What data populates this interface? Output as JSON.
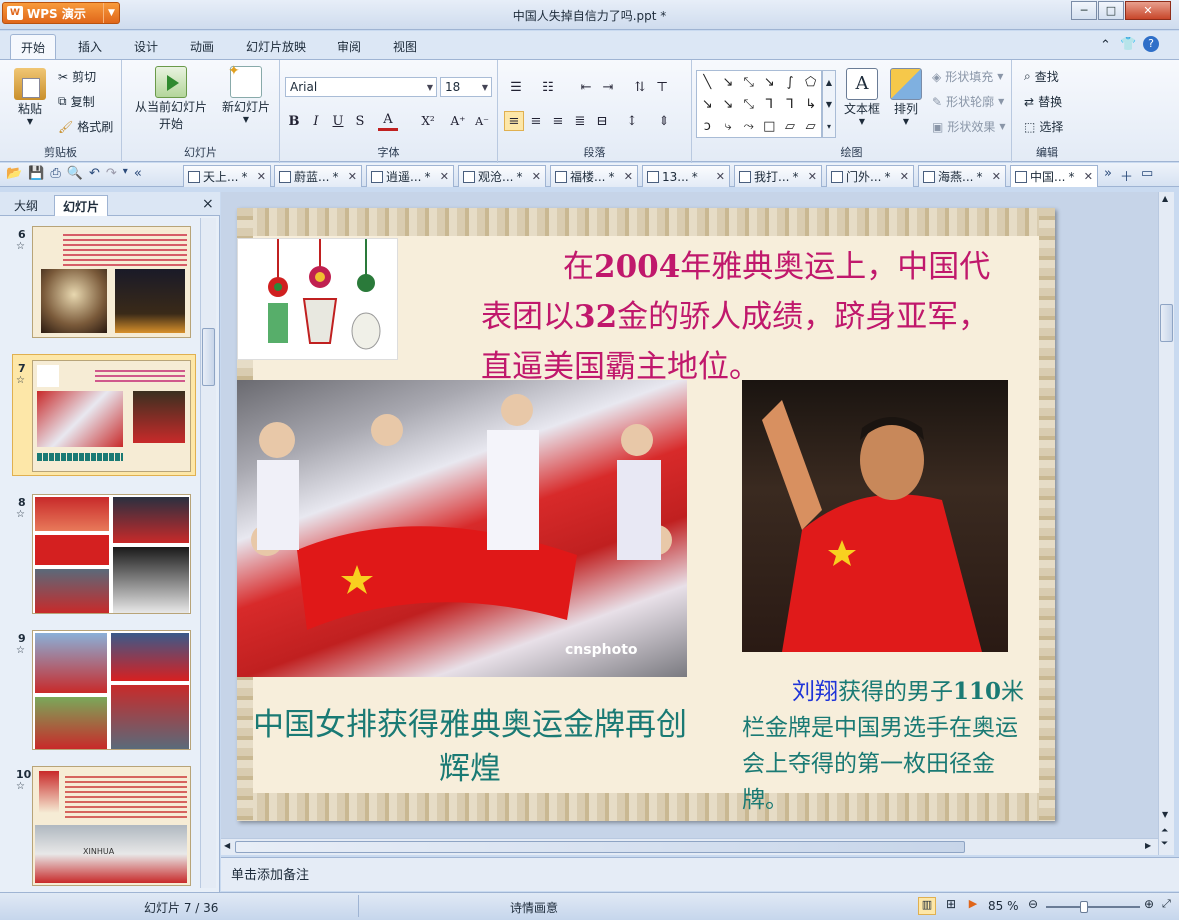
{
  "app": {
    "name": "WPS 演示",
    "doc_title": "中国人失掉自信力了吗.ppt *"
  },
  "window_controls": {
    "minimize": "─",
    "maximize": "□",
    "close": "✕"
  },
  "menu": {
    "tabs": [
      "开始",
      "插入",
      "设计",
      "动画",
      "幻灯片放映",
      "审阅",
      "视图"
    ],
    "right_icons": [
      "⌃",
      "👕",
      "?"
    ]
  },
  "ribbon": {
    "clipboard": {
      "paste": "粘贴",
      "cut": "剪切",
      "copy": "复制",
      "format_painter": "格式刷",
      "label": "剪贴板"
    },
    "slides": {
      "from_current": "从当前幻灯片",
      "from_current_2": "开始",
      "new_slide": "新幻灯片",
      "label": "幻灯片"
    },
    "font": {
      "name": "Arial",
      "size": "18",
      "label": "字体",
      "bold": "B",
      "italic": "I",
      "underline": "U",
      "strike": "S",
      "color": "A",
      "superscript": "X²",
      "grow": "A⁺",
      "shrink": "A⁻"
    },
    "paragraph": {
      "label": "段落"
    },
    "drawing": {
      "textbox": "文本框",
      "arrange": "排列",
      "fill": "形状填充",
      "outline": "形状轮廓",
      "effect": "形状效果",
      "label": "绘图"
    },
    "editing": {
      "find": "查找",
      "replace": "替换",
      "select": "选择",
      "label": "编辑"
    }
  },
  "doc_tabs": [
    "天上...",
    "蔚蓝...",
    "逍遥...",
    "观沧...",
    "福楼...",
    "13...",
    "我打...",
    "门外...",
    "海燕...",
    "中国..."
  ],
  "doc_tab_suffix": "*",
  "left_panel": {
    "tabs": [
      "大纲",
      "幻灯片"
    ],
    "close": "×",
    "slides": [
      {
        "num": "6",
        "star": "☆"
      },
      {
        "num": "7",
        "star": "☆"
      },
      {
        "num": "8",
        "star": "☆"
      },
      {
        "num": "9",
        "star": "☆"
      },
      {
        "num": "10",
        "star": "☆"
      }
    ],
    "thumb10_banner": "XINHUA"
  },
  "slide": {
    "text_top_1": "在",
    "text_top_year": "2004",
    "text_top_2": "年雅典奥运上，中国代表团以",
    "text_top_gold": "32",
    "text_top_3": "金的骄人成绩，跻身亚军，直逼美国霸主地位。",
    "caption_left": "中国女排获得雅典奥运金牌再创辉煌",
    "caption_right_name": "刘翔",
    "caption_right_rest_1": "获得的男子",
    "caption_right_num": "110",
    "caption_right_rest_2": "米栏金牌是中国男选手在奥运会上夺得的第一枚田径金牌。",
    "watermark": "cnsphoto"
  },
  "notes": {
    "placeholder": "单击添加备注"
  },
  "status": {
    "slide_count": "幻灯片 7 / 36",
    "theme": "诗情画意",
    "zoom": "85 %"
  },
  "colors": {
    "magenta": "#c0186c",
    "teal": "#1a7a74",
    "blue": "#1f34d8",
    "accent": "#e0661a"
  }
}
